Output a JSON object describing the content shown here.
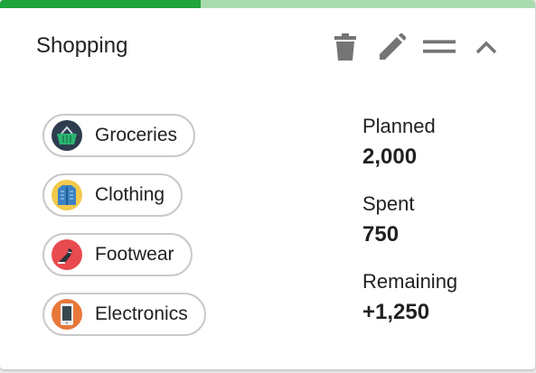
{
  "card": {
    "title": "Shopping",
    "progress_fraction": 0.375,
    "colors": {
      "progress_fill": "#1fa33b",
      "progress_track": "#a8dcae"
    }
  },
  "toolbar": [
    {
      "icon": "trash-icon"
    },
    {
      "icon": "pencil-icon"
    },
    {
      "icon": "drag-handle-icon"
    },
    {
      "icon": "chevron-up-icon"
    }
  ],
  "categories": [
    {
      "label": "Groceries",
      "icon": "basket-icon",
      "color": "#2d3d4f"
    },
    {
      "label": "Clothing",
      "icon": "jacket-icon",
      "color": "#f2c94c"
    },
    {
      "label": "Footwear",
      "icon": "sneaker-icon",
      "color": "#e84a4f"
    },
    {
      "label": "Electronics",
      "icon": "phone-icon",
      "color": "#e8783a"
    }
  ],
  "stats": [
    {
      "label": "Planned",
      "value": "2,000"
    },
    {
      "label": "Spent",
      "value": "750"
    },
    {
      "label": "Remaining",
      "value": "+1,250"
    }
  ]
}
